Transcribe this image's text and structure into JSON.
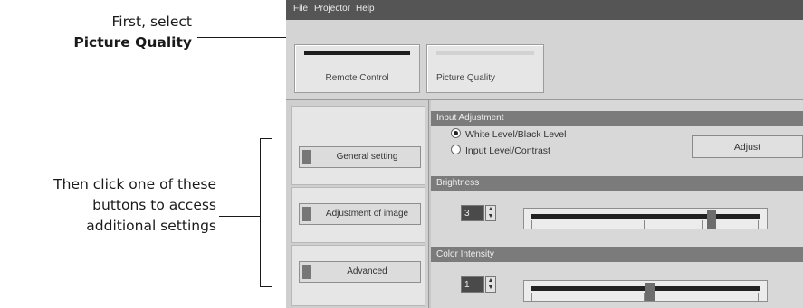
{
  "callouts": {
    "top_line1": "First, select",
    "top_line2": "Picture Quality",
    "left_line1": "Then click one of these",
    "left_line2": "buttons to access",
    "left_line3": "additional settings"
  },
  "menu": [
    "File",
    "Projector",
    "Help"
  ],
  "top_tabs": {
    "remote_control": "Remote Control",
    "picture_quality": "Picture Quality"
  },
  "side_buttons": {
    "general": "General setting",
    "adjustment": "Adjustment of image",
    "advanced": "Advanced"
  },
  "input_adjustment": {
    "header": "Input Adjustment",
    "option1": "White Level/Black Level",
    "option2": "Input Level/Contrast",
    "selected": "White Level/Black Level",
    "adjust_button": "Adjust"
  },
  "brightness": {
    "header": "Brightness",
    "value": "3",
    "level": 0.8
  },
  "color_intensity": {
    "header": "Color Intensity",
    "value": "1",
    "level": 0.52
  }
}
